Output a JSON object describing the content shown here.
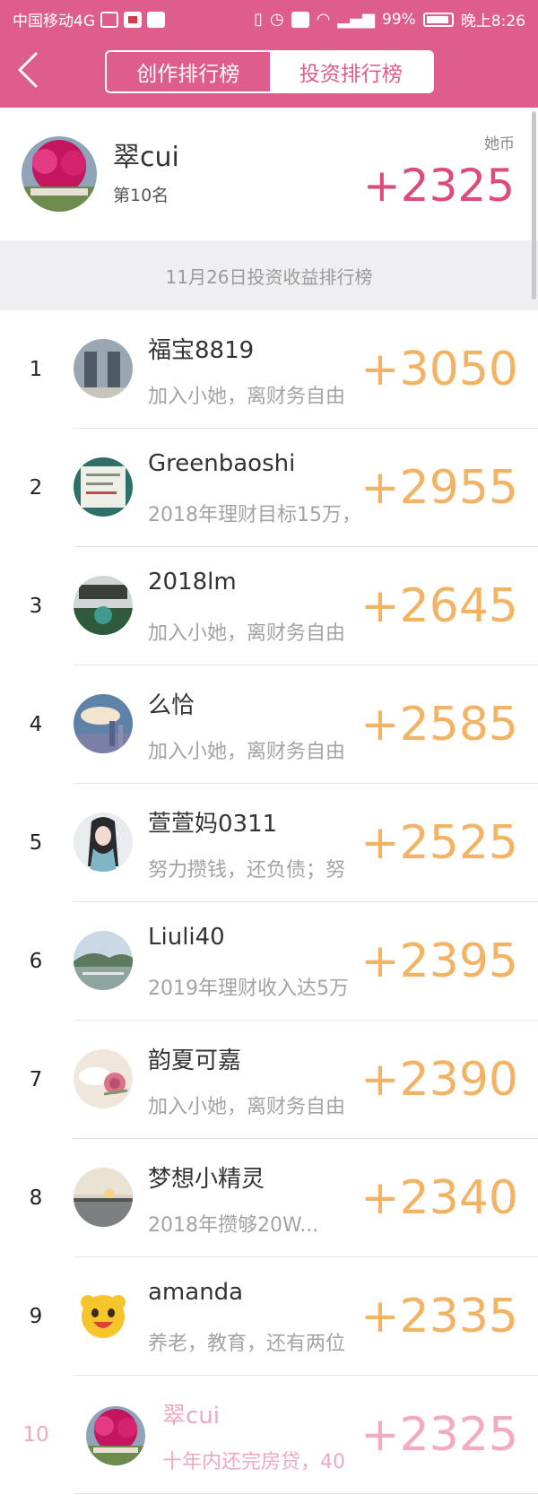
{
  "status_bar": {
    "carrier": "中国移动4G",
    "battery": "99%",
    "time": "晚上8:26",
    "network_badge": "4G"
  },
  "tabs": [
    {
      "label": "创作排行榜",
      "active": false
    },
    {
      "label": "投资排行榜",
      "active": true
    }
  ],
  "me": {
    "name": "翠cui",
    "rank_text": "第10名",
    "unit": "她币",
    "score": "+2325"
  },
  "date_banner": "11月26日投资收益排行榜",
  "leaderboard": [
    {
      "rank": "1",
      "name": "福宝8819",
      "motto": "加入小她，离财务自由",
      "score": "+3050"
    },
    {
      "rank": "2",
      "name": "Greenbaoshi",
      "motto": "2018年理财目标15万，",
      "score": "+2955"
    },
    {
      "rank": "3",
      "name": "2018lm",
      "motto": "加入小她，离财务自由",
      "score": "+2645"
    },
    {
      "rank": "4",
      "name": "么恰",
      "motto": "加入小她，离财务自由",
      "score": "+2585"
    },
    {
      "rank": "5",
      "name": "萱萱妈0311",
      "motto": "努力攒钱，还负债；努",
      "score": "+2525"
    },
    {
      "rank": "6",
      "name": "Liuli40",
      "motto": "2019年理财收入达5万",
      "score": "+2395"
    },
    {
      "rank": "7",
      "name": "韵夏可嘉",
      "motto": "加入小她，离财务自由",
      "score": "+2390"
    },
    {
      "rank": "8",
      "name": "梦想小精灵",
      "motto": "2018年攒够20W...",
      "score": "+2340"
    },
    {
      "rank": "9",
      "name": "amanda",
      "motto": "养老，教育，还有两位",
      "score": "+2335"
    },
    {
      "rank": "10",
      "name": "翠cui",
      "motto": "十年内还完房贷，40",
      "score": "+2325"
    }
  ],
  "colors": {
    "brand_pink": "#df5d8a",
    "score_orange": "#f2b364",
    "my_score": "#d94c7d",
    "highlight_row": "#f0a8c0"
  }
}
